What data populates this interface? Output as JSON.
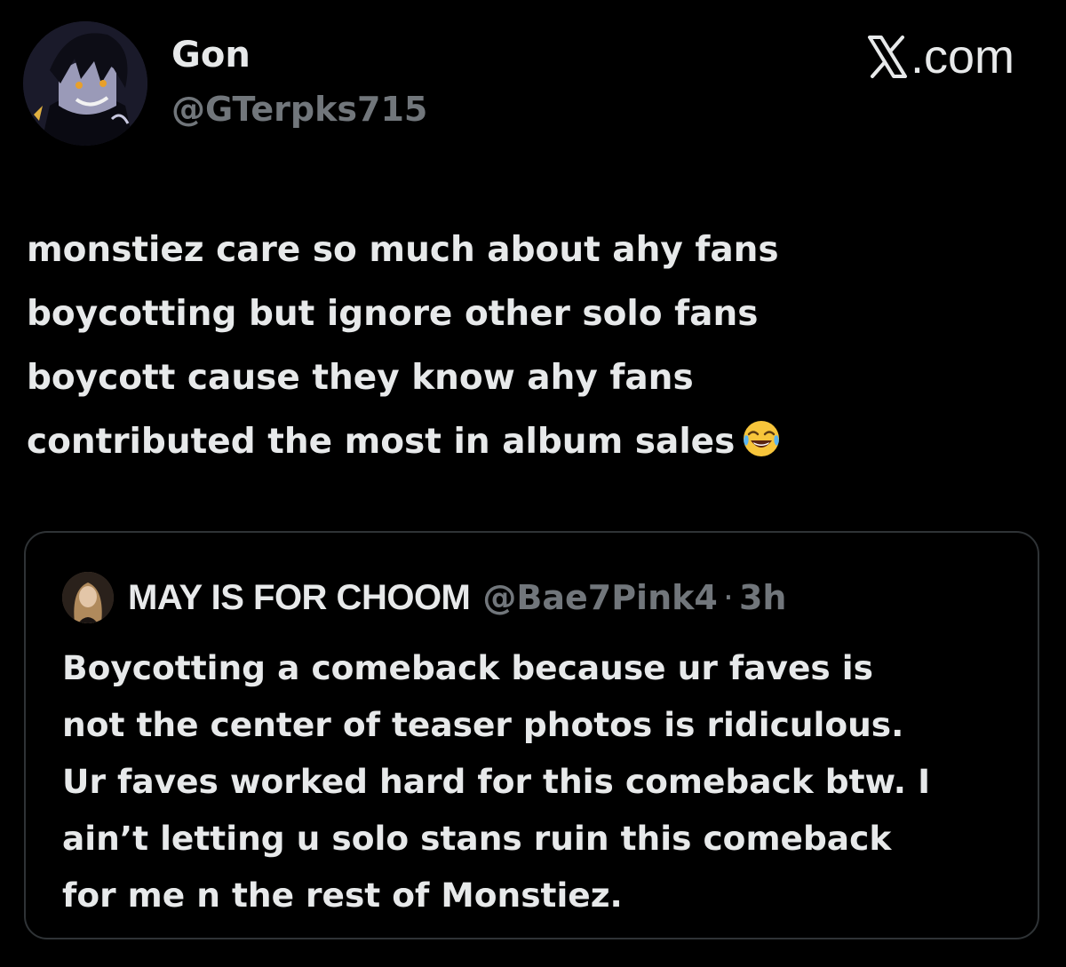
{
  "post": {
    "author": {
      "display_name": "Gon",
      "handle": "@GTerpks715",
      "avatar_icon": "avatar-anime-character"
    },
    "brand": {
      "icon": "x-logo-icon",
      "label": ".com"
    },
    "text_lines": [
      "monstiez care so much about ahy fans",
      "boycotting but ignore other solo fans",
      "boycott cause they know ahy fans",
      "contributed the most in album sales"
    ],
    "emoji": "face-with-tears-of-joy-icon"
  },
  "quoted_post": {
    "author": {
      "display_name": "MAY IS FOR CHOOM",
      "handle": "@Bae7Pink4",
      "avatar_icon": "avatar-photo"
    },
    "separator": "·",
    "time": "3h",
    "text_lines": [
      "Boycotting a comeback because ur faves is",
      "not the center of teaser photos is ridiculous.",
      "Ur faves worked hard for this comeback btw. I",
      "ain’t letting u solo stans ruin this comeback",
      "for me n the rest of Monstiez."
    ]
  },
  "colors": {
    "background": "#000000",
    "primary_text": "#e7e9ea",
    "secondary_text": "#71767b",
    "border": "#2f3336"
  }
}
